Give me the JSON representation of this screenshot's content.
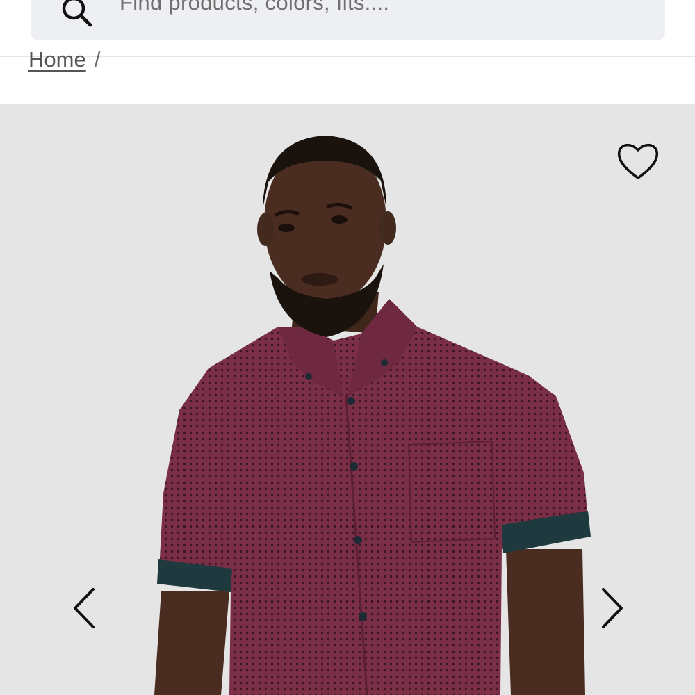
{
  "header": {
    "search": {
      "placeholder": "Find products, colors, fits...."
    }
  },
  "breadcrumb": {
    "items": [
      {
        "label": "Home"
      }
    ],
    "separator": "/"
  },
  "gallery": {
    "image_description_icon": "model-photo",
    "wishlist_icon": "heart-outline-icon",
    "prev_icon": "chevron-left-icon",
    "next_icon": "chevron-right-icon"
  },
  "colors": {
    "search_bg": "#eeeff3",
    "gallery_bg": "#e5e5e5",
    "shirt": "#7a2e45",
    "cuff": "#1f3a3e",
    "skin": "#4a2d20"
  }
}
